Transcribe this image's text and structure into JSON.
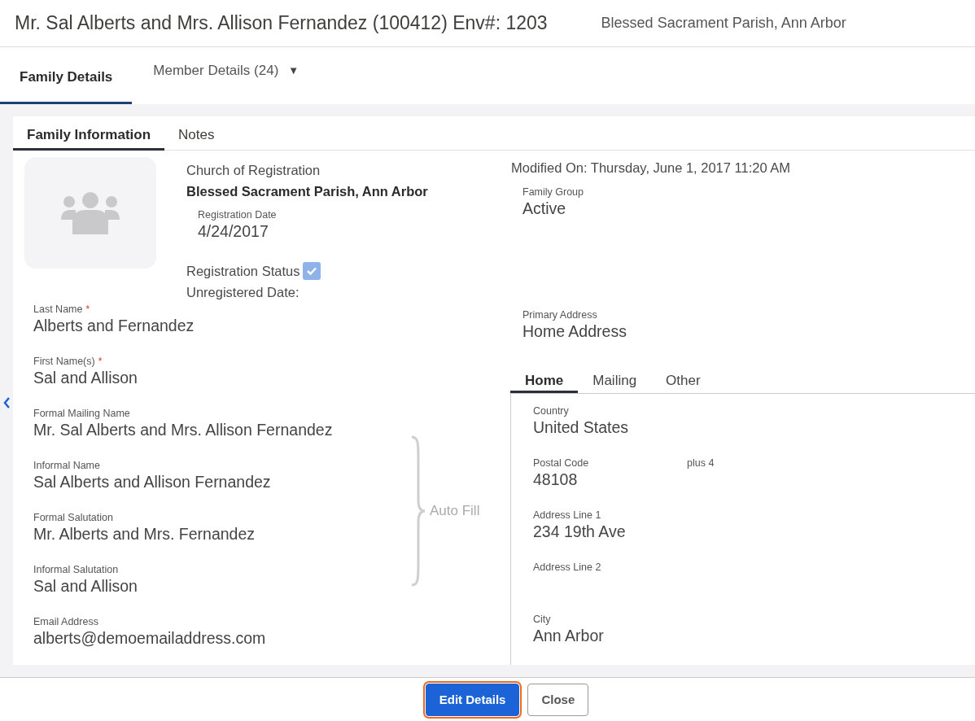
{
  "header": {
    "title": "Mr. Sal Alberts and Mrs. Allison Fernandez (100412) Env#: 1203",
    "parish": "Blessed Sacrament Parish, Ann Arbor"
  },
  "main_tabs": [
    {
      "label": "Family Details",
      "selected": true
    },
    {
      "label": "Member Details (24)",
      "selected": false,
      "caret": "▼"
    }
  ],
  "card_tabs": [
    {
      "label": "Family Information",
      "selected": true
    },
    {
      "label": "Notes",
      "selected": false
    }
  ],
  "left": {
    "church_label": "Church of Registration",
    "church": "Blessed Sacrament Parish, Ann Arbor",
    "registration_date": {
      "label": "Registration Date",
      "value": "4/24/2017"
    },
    "registration_status": {
      "label": "Registration Status",
      "checked": true
    },
    "unregistered_label": "Unregistered Date:",
    "fields": [
      {
        "label": "Last Name",
        "value": "Alberts and Fernandez",
        "required_mark": "*"
      },
      {
        "label": "First Name(s)",
        "value": "Sal and Allison",
        "required_mark": "*"
      }
    ],
    "auto_fill": {
      "label": "Auto Fill",
      "fields": [
        {
          "label": "Formal Mailing Name",
          "value": "Mr. Sal Alberts and Mrs. Allison Fernandez"
        },
        {
          "label": "Informal Name",
          "value": "Sal Alberts and Allison Fernandez"
        },
        {
          "label": "Formal Salutation",
          "value": "Mr. Alberts and Mrs. Fernandez"
        },
        {
          "label": "Informal Salutation",
          "value": "Sal and Allison"
        }
      ]
    },
    "email": {
      "label": "Email Address",
      "value": "alberts@demoemailaddress.com"
    }
  },
  "right": {
    "modified": "Modified On: Thursday, June 1, 2017 11:20 AM",
    "family_group": {
      "label": "Family Group",
      "value": "Active"
    },
    "primary_address": {
      "label": "Primary Address",
      "value": "Home Address"
    },
    "address_tabs": [
      {
        "label": "Home",
        "selected": true
      },
      {
        "label": "Mailing",
        "selected": false
      },
      {
        "label": "Other",
        "selected": false
      }
    ],
    "address_fields": [
      {
        "label": "Country",
        "value": "United States"
      },
      {
        "label": "Postal Code",
        "value": "48108",
        "extra_label": "plus 4"
      },
      {
        "label": "Address Line 1",
        "value": "234 19th Ave"
      },
      {
        "label": "Address Line 2"
      },
      {
        "label": "City",
        "value": "Ann Arbor"
      }
    ]
  },
  "buttons": [
    {
      "label": "Edit Details",
      "kind": "primary",
      "focused": true
    },
    {
      "label": "Close",
      "kind": "secondary",
      "focused": false
    }
  ]
}
